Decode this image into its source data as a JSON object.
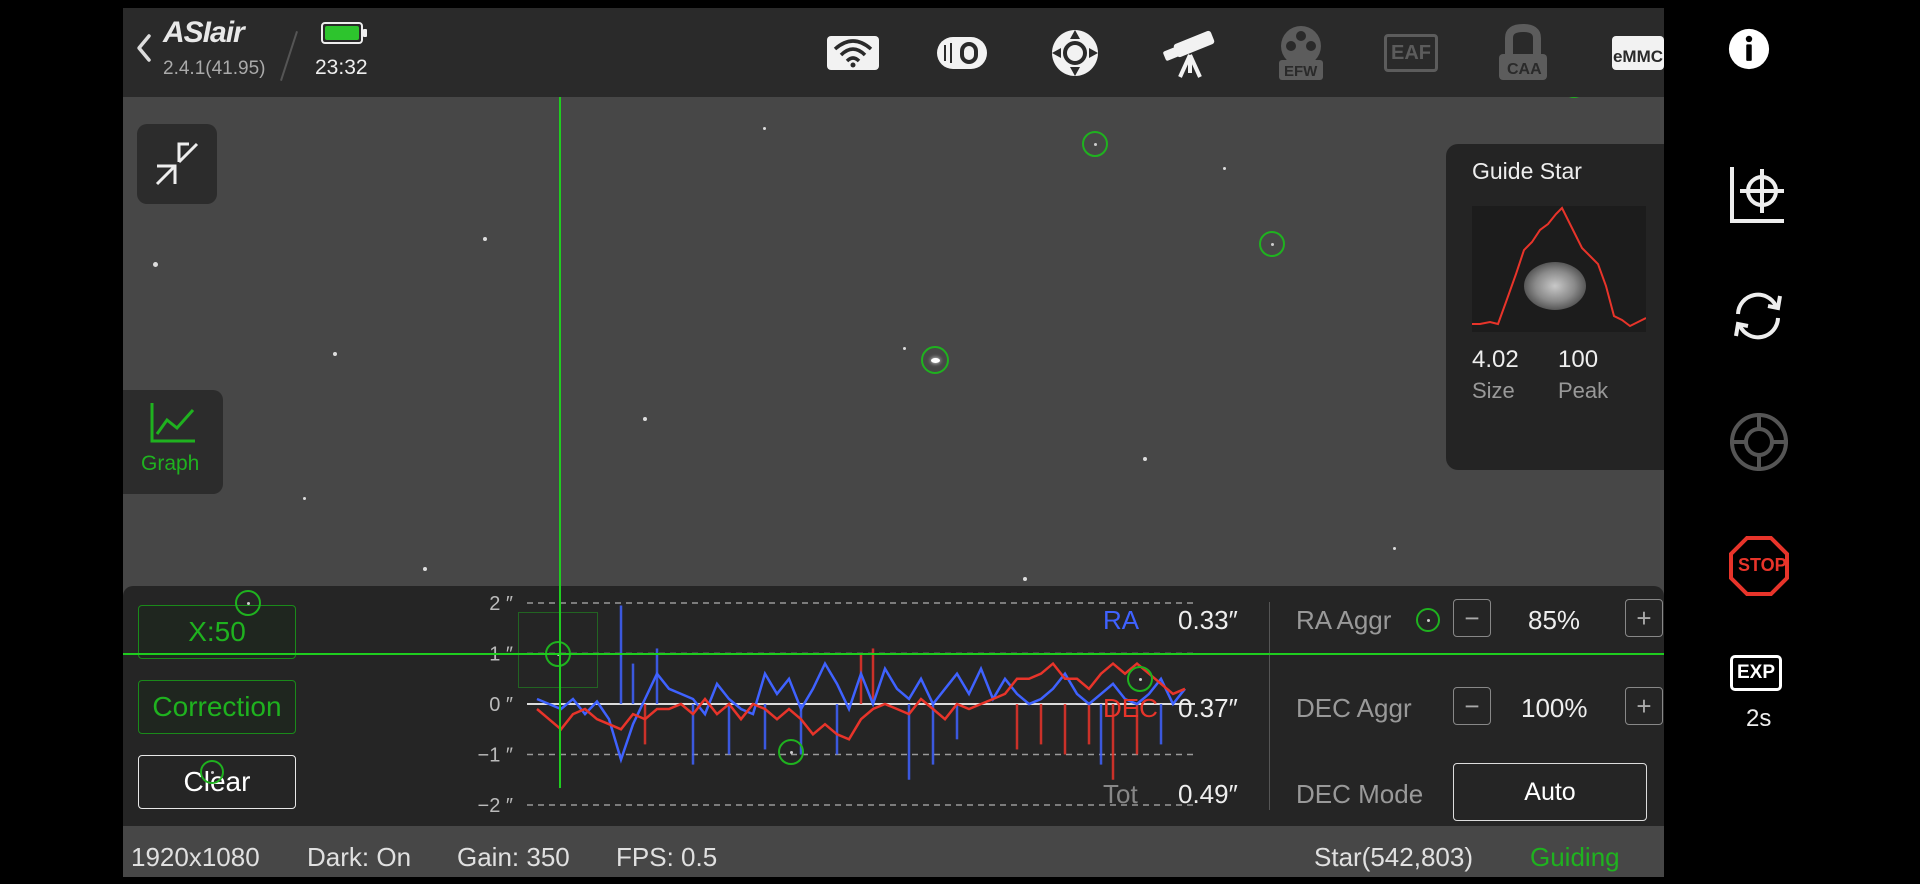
{
  "header": {
    "brand": "ASIair",
    "version": "2.4.1(41.95)",
    "time": "23:32",
    "icons": [
      "wifi-icon",
      "focuser-icon",
      "guide-scope-icon",
      "telescope-icon",
      "efw-icon",
      "eaf-icon",
      "caa-icon",
      "emmc-icon"
    ],
    "efw_label": "EFW",
    "eaf_label": "EAF",
    "caa_label": "CAA",
    "emmc_label": "eMMC"
  },
  "side_left": {
    "graph_label": "Graph"
  },
  "guide_star": {
    "title": "Guide Star",
    "size_value": "4.02",
    "size_label": "Size",
    "peak_value": "100",
    "peak_label": "Peak"
  },
  "graph": {
    "x_scale_label": "X:50",
    "correction_label": "Correction",
    "clear_label": "Clear",
    "y_ticks": [
      "2 ″",
      "1 ″",
      "0 ″",
      "−1 ″",
      "−2 ″"
    ],
    "ra_label": "RA",
    "ra_value": "0.33″",
    "dec_label": "DEC",
    "dec_value": "0.37″",
    "tot_label": "Tot",
    "tot_value": "0.49″",
    "ra_aggr_label": "RA Aggr",
    "ra_aggr_value": "85%",
    "dec_aggr_label": "DEC Aggr",
    "dec_aggr_value": "100%",
    "dec_mode_label": "DEC Mode",
    "dec_mode_value": "Auto",
    "minus": "−",
    "plus": "+"
  },
  "status_bar": {
    "resolution": "1920x1080",
    "dark": "Dark: On",
    "gain": "Gain: 350",
    "fps": "FPS: 0.5",
    "star": "Star(542,803)",
    "state": "Guiding"
  },
  "side_right": {
    "exp_label": "EXP",
    "exp_value": "2s",
    "stop_label": "STOP"
  },
  "colors": {
    "accent_green": "#1fb21f",
    "ra_blue": "#3f62ff",
    "dec_red": "#e8342a",
    "stop_red": "#e8342a"
  },
  "chart_data": {
    "type": "line",
    "ylim": [
      -2,
      2
    ],
    "series": [
      {
        "name": "RA",
        "values": [
          0.1,
          0.0,
          -0.1,
          0.1,
          -0.2,
          0.05,
          -0.3,
          -1.1,
          -0.4,
          0.1,
          0.6,
          0.3,
          0.2,
          0.1,
          -0.2,
          0.4,
          0.1,
          -0.1,
          -0.2,
          0.6,
          0.2,
          0.5,
          -0.1,
          0.3,
          0.8,
          0.4,
          -0.1,
          0.6,
          0.0,
          0.7,
          0.3,
          0.1,
          0.5,
          0.0,
          0.3,
          0.6,
          0.2,
          0.7,
          0.1,
          0.5,
          0.2,
          0.0,
          0.1,
          0.3,
          0.6,
          0.2,
          0.0,
          0.2,
          0.4,
          0.1,
          0.0,
          0.2,
          0.5,
          0.0,
          0.3
        ]
      },
      {
        "name": "DEC",
        "values": [
          -0.1,
          -0.3,
          -0.5,
          -0.2,
          -0.1,
          -0.3,
          -0.4,
          -0.5,
          -0.2,
          -0.3,
          -0.1,
          -0.1,
          0.0,
          -0.2,
          0.1,
          -0.2,
          0.0,
          -0.3,
          0.0,
          -0.1,
          -0.3,
          -0.1,
          -0.3,
          -0.6,
          -0.4,
          -0.6,
          -0.7,
          -0.3,
          -0.1,
          0.0,
          -0.1,
          -0.2,
          0.1,
          -0.1,
          -0.3,
          0.0,
          -0.1,
          0.0,
          0.1,
          0.2,
          0.5,
          0.5,
          0.6,
          0.8,
          0.5,
          0.5,
          0.3,
          0.6,
          0.8,
          0.6,
          0.8,
          0.6,
          0.4,
          0.2,
          0.3
        ]
      }
    ]
  }
}
